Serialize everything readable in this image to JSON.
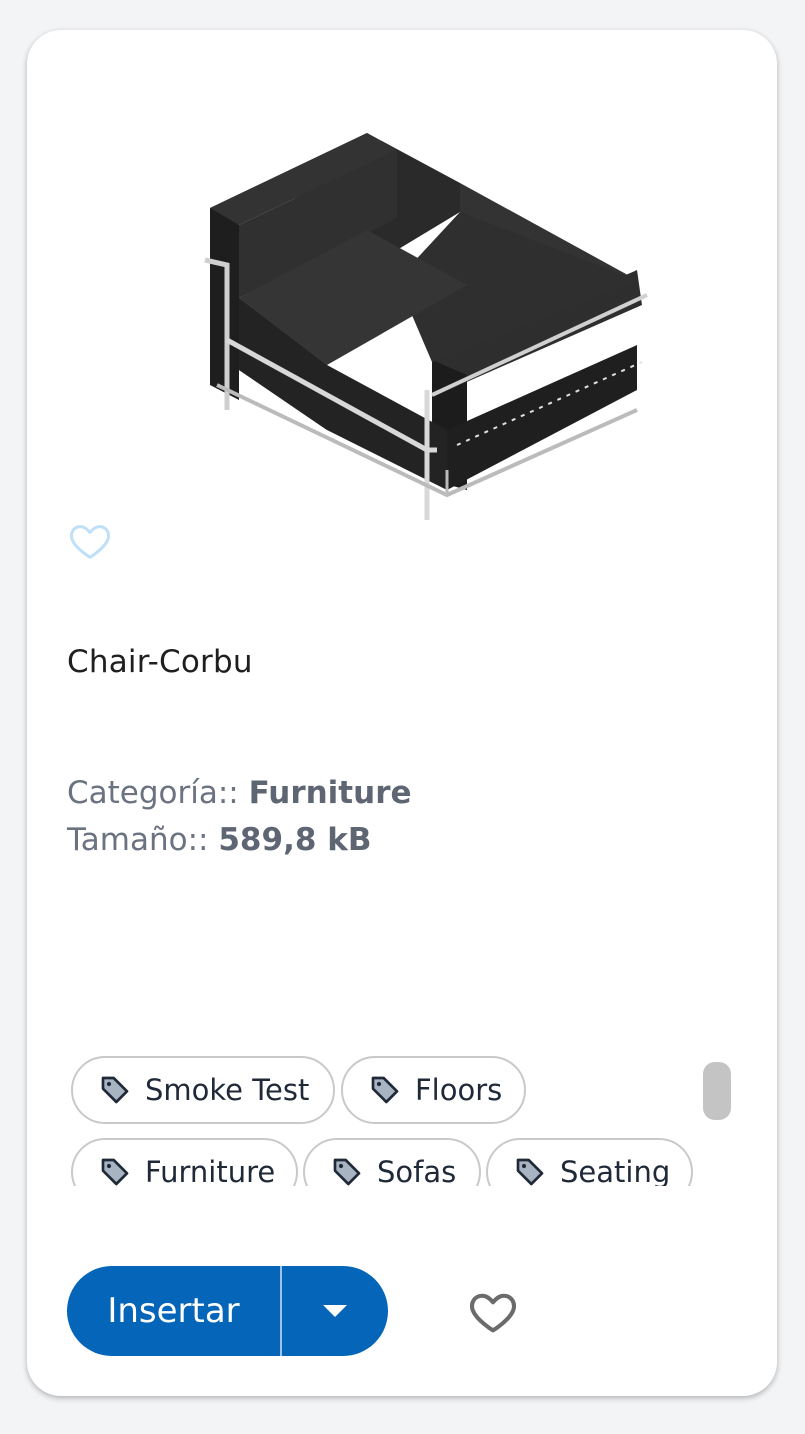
{
  "item": {
    "title": "Chair-Corbu",
    "category_label": "Categoría::",
    "category_value": "Furniture",
    "size_label": "Tamaño::",
    "size_value": "589,8 kB"
  },
  "tags": [
    "Smoke Test",
    "Floors",
    "Furniture",
    "Sofas",
    "Seating"
  ],
  "actions": {
    "insert_label": "Insertar",
    "dropdown_icon": "caret-down-icon",
    "favorite_icon": "heart-outline-icon"
  },
  "colors": {
    "primary": "#0565b8",
    "favorite_small": "#bfe0f7",
    "favorite_big": "#6b6b6b",
    "page_bg": "#f3f4f6"
  }
}
